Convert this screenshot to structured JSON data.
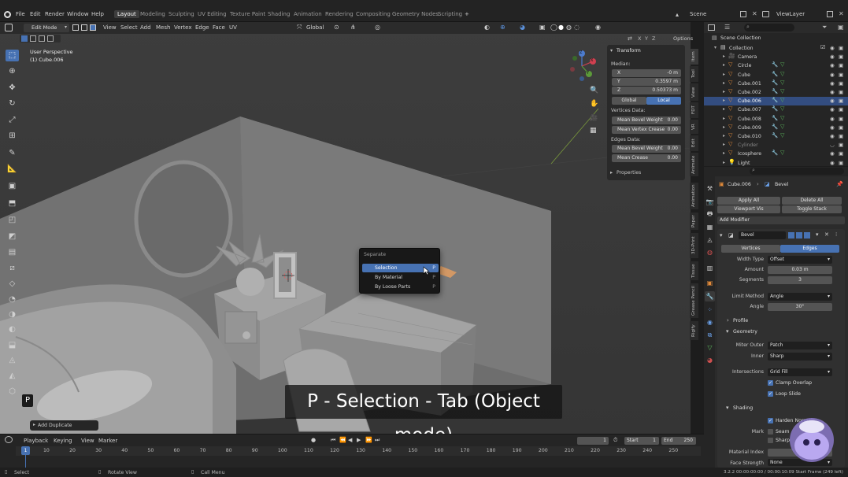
{
  "topbar": {
    "menus": [
      "File",
      "Edit",
      "Render",
      "Window",
      "Help"
    ],
    "workspaces": [
      "Layout",
      "Modeling",
      "Sculpting",
      "UV Editing",
      "Texture Paint",
      "Shading",
      "Animation",
      "Rendering",
      "Compositing",
      "Geometry Nodes",
      "Scripting"
    ],
    "active_workspace": "Layout",
    "add_workspace": "+",
    "scene": "Scene",
    "view_layer": "ViewLayer"
  },
  "viewport_header": {
    "mode": "Edit Mode",
    "menus": [
      "View",
      "Select",
      "Add",
      "Mesh",
      "Vertex",
      "Edge",
      "Face",
      "UV"
    ],
    "orientation": "Global",
    "options": "Options",
    "xyz": [
      "X",
      "Y",
      "Z"
    ]
  },
  "viewport": {
    "view_name": "User Perspective",
    "object_name": "(1) Cube.006",
    "key_indicator": "P",
    "last_op": "Add Duplicate",
    "caption": "P - Selection - Tab (Object mode)",
    "gizmo": {
      "x": "X",
      "y": "Y",
      "z": "Z"
    }
  },
  "separate_menu": {
    "title": "Separate",
    "items": [
      {
        "label": "Selection",
        "shortcut": "P",
        "highlighted": true
      },
      {
        "label": "By Material",
        "shortcut": "P",
        "highlighted": false
      },
      {
        "label": "By Loose Parts",
        "shortcut": "P",
        "highlighted": false
      }
    ]
  },
  "transform_panel": {
    "title": "Transform",
    "median_label": "Median:",
    "x_label": "X",
    "x_value": "-0 m",
    "y_label": "Y",
    "y_value": "0.3597 m",
    "z_label": "Z",
    "z_value": "0.50373 m",
    "global": "Global",
    "local": "Local",
    "vertices_data": "Vertices Data:",
    "mean_bevel_weight": "Mean Bevel Weight",
    "mbw_value": "0.00",
    "mean_vertex_crease": "Mean Vertex Crease",
    "mvc_value": "0.00",
    "edges_data": "Edges Data:",
    "edge_bevel_weight": "Mean Bevel Weight",
    "ebw_value": "0.00",
    "mean_crease": "Mean Crease",
    "mc_value": "0.00",
    "properties": "Properties"
  },
  "side_tabs": [
    "Item",
    "Tool",
    "View",
    "FDT",
    "VR",
    "Edit",
    "Animate"
  ],
  "outliner": {
    "title": "Scene Collection",
    "items": [
      {
        "name": "Collection",
        "kind": "collection"
      },
      {
        "name": "Camera",
        "kind": "camera"
      },
      {
        "name": "Circle",
        "kind": "mesh"
      },
      {
        "name": "Cube",
        "kind": "mesh"
      },
      {
        "name": "Cube.001",
        "kind": "mesh"
      },
      {
        "name": "Cube.002",
        "kind": "mesh"
      },
      {
        "name": "Cube.006",
        "kind": "mesh",
        "selected": true
      },
      {
        "name": "Cube.007",
        "kind": "mesh"
      },
      {
        "name": "Cube.008",
        "kind": "mesh"
      },
      {
        "name": "Cube.009",
        "kind": "mesh"
      },
      {
        "name": "Cube.010",
        "kind": "mesh"
      },
      {
        "name": "Cylinder",
        "kind": "mesh",
        "dim": true
      },
      {
        "name": "Icosphere",
        "kind": "mesh"
      },
      {
        "name": "Light",
        "kind": "light"
      }
    ]
  },
  "properties": {
    "breadcrumb_object": "Cube.006",
    "breadcrumb_modifier": "Bevel",
    "apply_all": "Apply All",
    "delete_all": "Delete All",
    "viewport_vis": "Viewport Vis",
    "toggle_stack": "Toggle Stack",
    "add_modifier": "Add Modifier",
    "modifier_name": "Bevel",
    "vertices": "Vertices",
    "edges": "Edges",
    "width_type_label": "Width Type",
    "width_type": "Offset",
    "amount_label": "Amount",
    "amount": "0.03 m",
    "segments_label": "Segments",
    "segments": "3",
    "limit_method_label": "Limit Method",
    "limit_method": "Angle",
    "angle_label": "Angle",
    "angle": "30°",
    "profile": "Profile",
    "geometry": "Geometry",
    "miter_outer_label": "Miter Outer",
    "miter_outer": "Patch",
    "inner_label": "Inner",
    "inner": "Sharp",
    "intersections_label": "Intersections",
    "intersections": "Grid Fill",
    "clamp_overlap": "Clamp Overlap",
    "loop_slide": "Loop Slide",
    "shading": "Shading",
    "harden_normals": "Harden Normals",
    "mark_label": "Mark",
    "seam": "Seam",
    "sharp": "Sharp",
    "material_index_label": "Material Index",
    "face_strength_label": "Face Strength",
    "face_strength": "None"
  },
  "prop_side_tabs": [
    "Animation",
    "Paper",
    "3D-Print",
    "Tissue",
    "Grease Pencil",
    "Rigify"
  ],
  "timeline": {
    "menus": [
      "Playback",
      "Keying",
      "View",
      "Marker"
    ],
    "current_frame": "1",
    "start_label": "Start",
    "start": "1",
    "end_label": "End",
    "end": "250",
    "ticks": [
      "10",
      "20",
      "30",
      "40",
      "50",
      "60",
      "70",
      "80",
      "90",
      "100",
      "110",
      "120",
      "130",
      "140",
      "150",
      "160",
      "170",
      "180",
      "190",
      "200",
      "210",
      "220",
      "230",
      "240",
      "250"
    ],
    "playhead": "1"
  },
  "statusbar": {
    "select": "Select",
    "rotate_view": "Rotate View",
    "call_menu": "Call Menu",
    "info": "3.2.2 00:00:00:00 / 00:00:10:09 Start Frame (249 left)"
  },
  "colors": {
    "accent": "#4772b3",
    "viewport": "#3c3c3c",
    "panel": "#2b2b2b"
  }
}
